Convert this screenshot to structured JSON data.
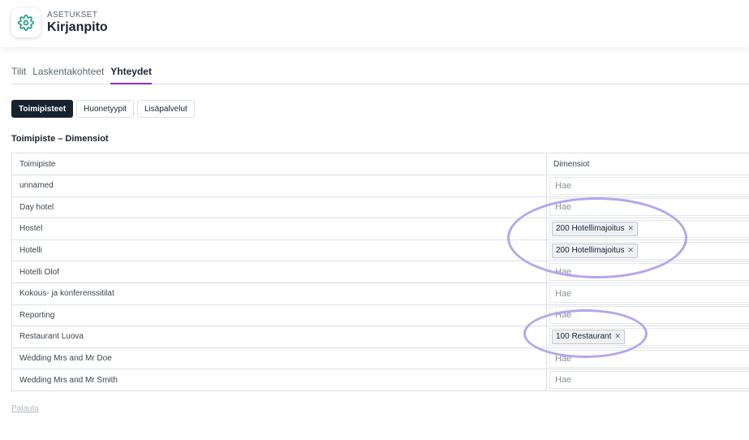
{
  "header": {
    "section_label": "ASETUKSET",
    "title": "Kirjanpito",
    "icon": "gear-icon"
  },
  "tabs": [
    {
      "label": "Tilit",
      "active": false
    },
    {
      "label": "Laskentakohteet",
      "active": false
    },
    {
      "label": "Yhteydet",
      "active": true
    }
  ],
  "subtabs": [
    {
      "label": "Toimipisteet",
      "active": true
    },
    {
      "label": "Huonetyypit",
      "active": false
    },
    {
      "label": "Lisäpalvelut",
      "active": false
    }
  ],
  "table": {
    "title": "Toimipiste – Dimensiot",
    "columns": [
      "Toimipiste",
      "Dimensiot"
    ],
    "placeholder": "Hae",
    "rows": [
      {
        "name": "unnamed",
        "dimension": ""
      },
      {
        "name": "Day hotel",
        "dimension": ""
      },
      {
        "name": "Hostel",
        "dimension": "200 Hotellimajoitus"
      },
      {
        "name": "Hotelli",
        "dimension": "200 Hotellimajoitus"
      },
      {
        "name": "Hotelli Olof",
        "dimension": ""
      },
      {
        "name": "Kokous- ja konferenssitilat",
        "dimension": ""
      },
      {
        "name": "Reporting",
        "dimension": ""
      },
      {
        "name": "Restaurant Luova",
        "dimension": "100 Restaurant"
      },
      {
        "name": "Wedding Mrs and Mr Doe",
        "dimension": ""
      },
      {
        "name": "Wedding Mrs and Mr Smith",
        "dimension": ""
      }
    ]
  },
  "footer": {
    "reset_label": "Palauta"
  },
  "colors": {
    "accent": "#8b2fc9",
    "icon_teal": "#1f9e88",
    "annotation": "#b6a5ea"
  }
}
